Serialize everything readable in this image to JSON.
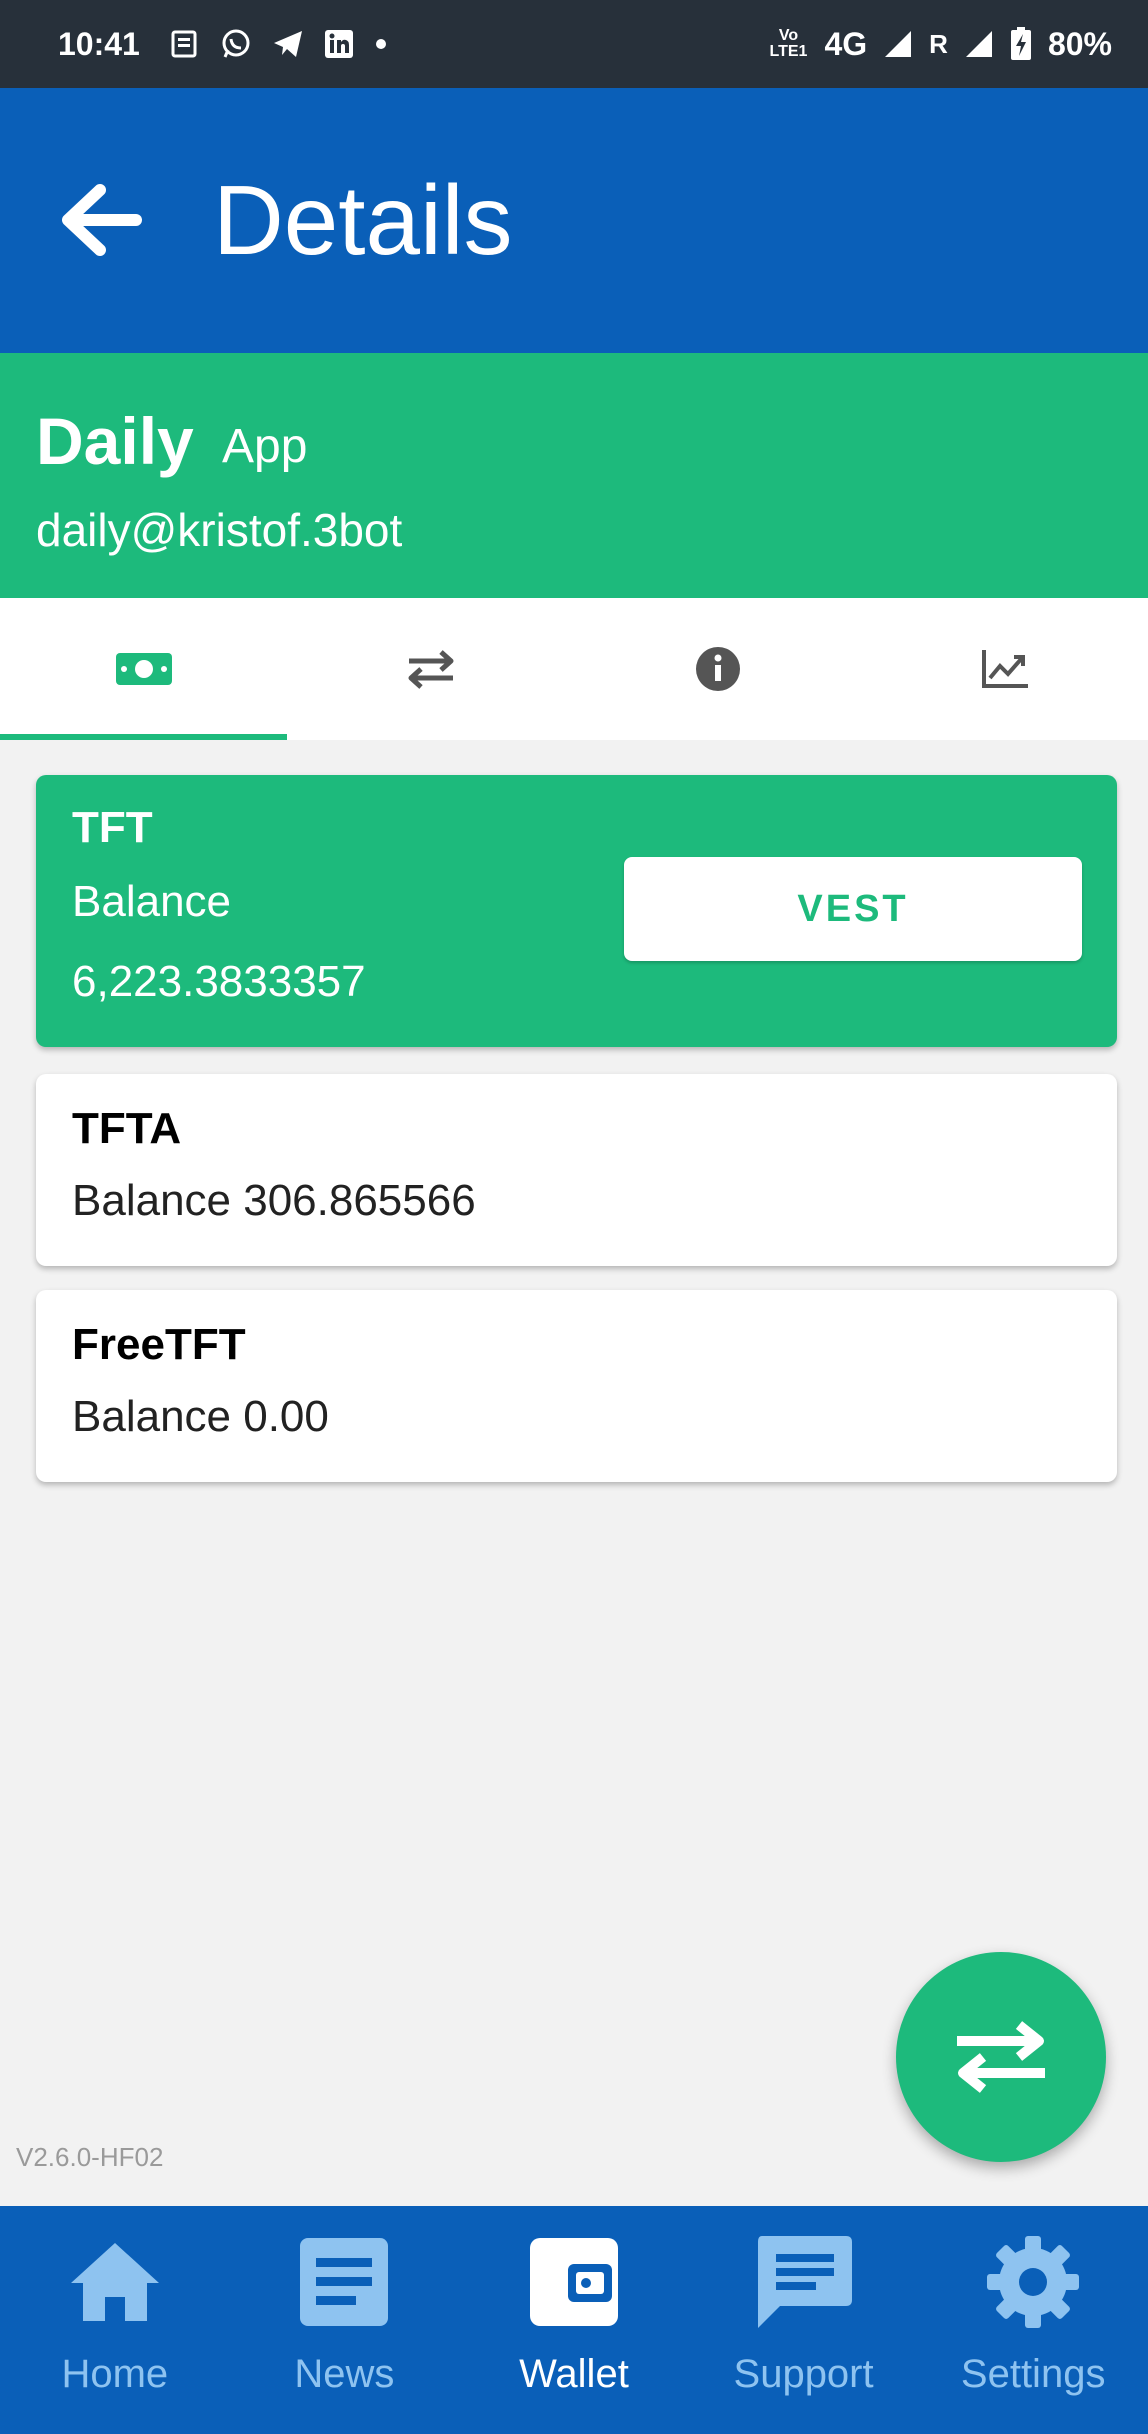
{
  "status_bar": {
    "time": "10:41",
    "network": "4G",
    "roaming": "R",
    "volte": "Vo LTE1",
    "battery": "80%",
    "notification_icons": [
      "news-icon",
      "whatsapp-icon",
      "telegram-icon",
      "linkedin-icon",
      "dot-icon"
    ]
  },
  "app_bar": {
    "title": "Details",
    "back_icon": "arrow-left-icon"
  },
  "account": {
    "name": "Daily",
    "type": "App",
    "email": "daily@kristof.3bot"
  },
  "tabs": [
    {
      "icon": "money-icon",
      "active": true
    },
    {
      "icon": "transfer-icon",
      "active": false
    },
    {
      "icon": "info-icon",
      "active": false
    },
    {
      "icon": "chart-icon",
      "active": false
    }
  ],
  "wallets": {
    "tft": {
      "name": "TFT",
      "balance_label": "Balance",
      "balance": "6,223.3833357",
      "vest_label": "VEST"
    },
    "tfta": {
      "name": "TFTA",
      "balance_text": "Balance 306.865566"
    },
    "freetft": {
      "name": "FreeTFT",
      "balance_text": "Balance 0.00"
    }
  },
  "version": "V2.6.0-HF02",
  "fab_icon": "swap-icon",
  "bottom_nav": [
    {
      "label": "Home",
      "icon": "home-icon",
      "active": false
    },
    {
      "label": "News",
      "icon": "news-icon",
      "active": false
    },
    {
      "label": "Wallet",
      "icon": "wallet-icon",
      "active": true
    },
    {
      "label": "Support",
      "icon": "chat-icon",
      "active": false
    },
    {
      "label": "Settings",
      "icon": "gear-icon",
      "active": false
    }
  ],
  "colors": {
    "primary": "#0a5fb8",
    "accent": "#1dba7c",
    "nav_inactive": "#8ec3f0",
    "background": "#f2f2f2"
  }
}
